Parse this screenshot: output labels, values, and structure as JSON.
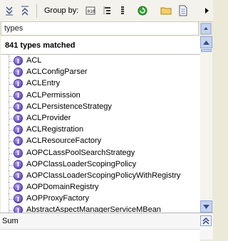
{
  "toolbar": {
    "group_by_label": "Group by:",
    "buttons": [
      {
        "name": "collapse-all-icon"
      },
      {
        "name": "expand-all-icon"
      },
      {
        "name": "group-by-type-icon"
      },
      {
        "name": "group-by-hierarchy-icon"
      },
      {
        "name": "group-by-list-icon"
      },
      {
        "name": "refresh-icon"
      },
      {
        "name": "folder-icon"
      },
      {
        "name": "document-icon"
      }
    ]
  },
  "filter": {
    "label": "types"
  },
  "results": {
    "count_label": "841 types matched",
    "items": [
      "ACL",
      "ACLConfigParser",
      "ACLEntry",
      "ACLPermission",
      "ACLPersistenceStrategy",
      "ACLProvider",
      "ACLRegistration",
      "ACLResourceFactory",
      "AOPCLassPoolSearchStrategy",
      "AOPClassLoaderScopingPolicy",
      "AOPClassLoaderScopingPolicyWithRegistry",
      "AOPDomainRegistry",
      "AOPProxyFactory",
      "AbstractAspectManagerServiceMBean"
    ]
  },
  "bottom": {
    "label": "Sum"
  },
  "colors": {
    "interface_icon": "#7a5fd8",
    "scroll_button": "#c5d3f0"
  }
}
